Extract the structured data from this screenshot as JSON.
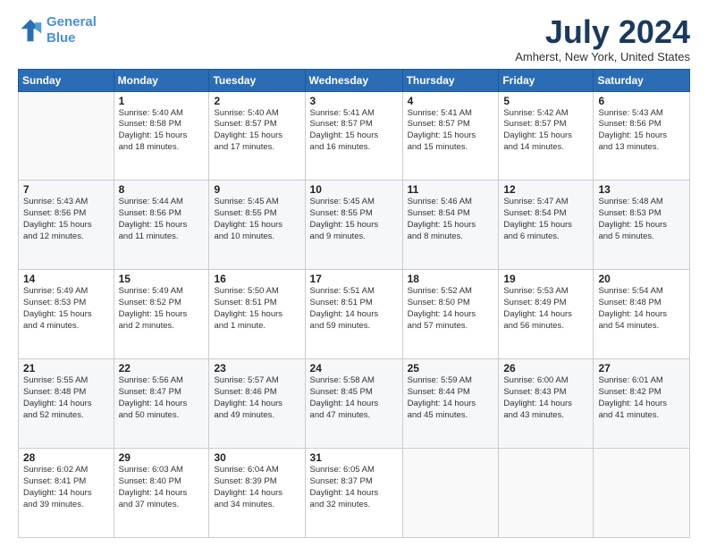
{
  "logo": {
    "line1": "General",
    "line2": "Blue"
  },
  "title": "July 2024",
  "location": "Amherst, New York, United States",
  "weekdays": [
    "Sunday",
    "Monday",
    "Tuesday",
    "Wednesday",
    "Thursday",
    "Friday",
    "Saturday"
  ],
  "weeks": [
    [
      {
        "day": "",
        "text": ""
      },
      {
        "day": "1",
        "text": "Sunrise: 5:40 AM\nSunset: 8:58 PM\nDaylight: 15 hours\nand 18 minutes."
      },
      {
        "day": "2",
        "text": "Sunrise: 5:40 AM\nSunset: 8:57 PM\nDaylight: 15 hours\nand 17 minutes."
      },
      {
        "day": "3",
        "text": "Sunrise: 5:41 AM\nSunset: 8:57 PM\nDaylight: 15 hours\nand 16 minutes."
      },
      {
        "day": "4",
        "text": "Sunrise: 5:41 AM\nSunset: 8:57 PM\nDaylight: 15 hours\nand 15 minutes."
      },
      {
        "day": "5",
        "text": "Sunrise: 5:42 AM\nSunset: 8:57 PM\nDaylight: 15 hours\nand 14 minutes."
      },
      {
        "day": "6",
        "text": "Sunrise: 5:43 AM\nSunset: 8:56 PM\nDaylight: 15 hours\nand 13 minutes."
      }
    ],
    [
      {
        "day": "7",
        "text": "Sunrise: 5:43 AM\nSunset: 8:56 PM\nDaylight: 15 hours\nand 12 minutes."
      },
      {
        "day": "8",
        "text": "Sunrise: 5:44 AM\nSunset: 8:56 PM\nDaylight: 15 hours\nand 11 minutes."
      },
      {
        "day": "9",
        "text": "Sunrise: 5:45 AM\nSunset: 8:55 PM\nDaylight: 15 hours\nand 10 minutes."
      },
      {
        "day": "10",
        "text": "Sunrise: 5:45 AM\nSunset: 8:55 PM\nDaylight: 15 hours\nand 9 minutes."
      },
      {
        "day": "11",
        "text": "Sunrise: 5:46 AM\nSunset: 8:54 PM\nDaylight: 15 hours\nand 8 minutes."
      },
      {
        "day": "12",
        "text": "Sunrise: 5:47 AM\nSunset: 8:54 PM\nDaylight: 15 hours\nand 6 minutes."
      },
      {
        "day": "13",
        "text": "Sunrise: 5:48 AM\nSunset: 8:53 PM\nDaylight: 15 hours\nand 5 minutes."
      }
    ],
    [
      {
        "day": "14",
        "text": "Sunrise: 5:49 AM\nSunset: 8:53 PM\nDaylight: 15 hours\nand 4 minutes."
      },
      {
        "day": "15",
        "text": "Sunrise: 5:49 AM\nSunset: 8:52 PM\nDaylight: 15 hours\nand 2 minutes."
      },
      {
        "day": "16",
        "text": "Sunrise: 5:50 AM\nSunset: 8:51 PM\nDaylight: 15 hours\nand 1 minute."
      },
      {
        "day": "17",
        "text": "Sunrise: 5:51 AM\nSunset: 8:51 PM\nDaylight: 14 hours\nand 59 minutes."
      },
      {
        "day": "18",
        "text": "Sunrise: 5:52 AM\nSunset: 8:50 PM\nDaylight: 14 hours\nand 57 minutes."
      },
      {
        "day": "19",
        "text": "Sunrise: 5:53 AM\nSunset: 8:49 PM\nDaylight: 14 hours\nand 56 minutes."
      },
      {
        "day": "20",
        "text": "Sunrise: 5:54 AM\nSunset: 8:48 PM\nDaylight: 14 hours\nand 54 minutes."
      }
    ],
    [
      {
        "day": "21",
        "text": "Sunrise: 5:55 AM\nSunset: 8:48 PM\nDaylight: 14 hours\nand 52 minutes."
      },
      {
        "day": "22",
        "text": "Sunrise: 5:56 AM\nSunset: 8:47 PM\nDaylight: 14 hours\nand 50 minutes."
      },
      {
        "day": "23",
        "text": "Sunrise: 5:57 AM\nSunset: 8:46 PM\nDaylight: 14 hours\nand 49 minutes."
      },
      {
        "day": "24",
        "text": "Sunrise: 5:58 AM\nSunset: 8:45 PM\nDaylight: 14 hours\nand 47 minutes."
      },
      {
        "day": "25",
        "text": "Sunrise: 5:59 AM\nSunset: 8:44 PM\nDaylight: 14 hours\nand 45 minutes."
      },
      {
        "day": "26",
        "text": "Sunrise: 6:00 AM\nSunset: 8:43 PM\nDaylight: 14 hours\nand 43 minutes."
      },
      {
        "day": "27",
        "text": "Sunrise: 6:01 AM\nSunset: 8:42 PM\nDaylight: 14 hours\nand 41 minutes."
      }
    ],
    [
      {
        "day": "28",
        "text": "Sunrise: 6:02 AM\nSunset: 8:41 PM\nDaylight: 14 hours\nand 39 minutes."
      },
      {
        "day": "29",
        "text": "Sunrise: 6:03 AM\nSunset: 8:40 PM\nDaylight: 14 hours\nand 37 minutes."
      },
      {
        "day": "30",
        "text": "Sunrise: 6:04 AM\nSunset: 8:39 PM\nDaylight: 14 hours\nand 34 minutes."
      },
      {
        "day": "31",
        "text": "Sunrise: 6:05 AM\nSunset: 8:37 PM\nDaylight: 14 hours\nand 32 minutes."
      },
      {
        "day": "",
        "text": ""
      },
      {
        "day": "",
        "text": ""
      },
      {
        "day": "",
        "text": ""
      }
    ]
  ]
}
